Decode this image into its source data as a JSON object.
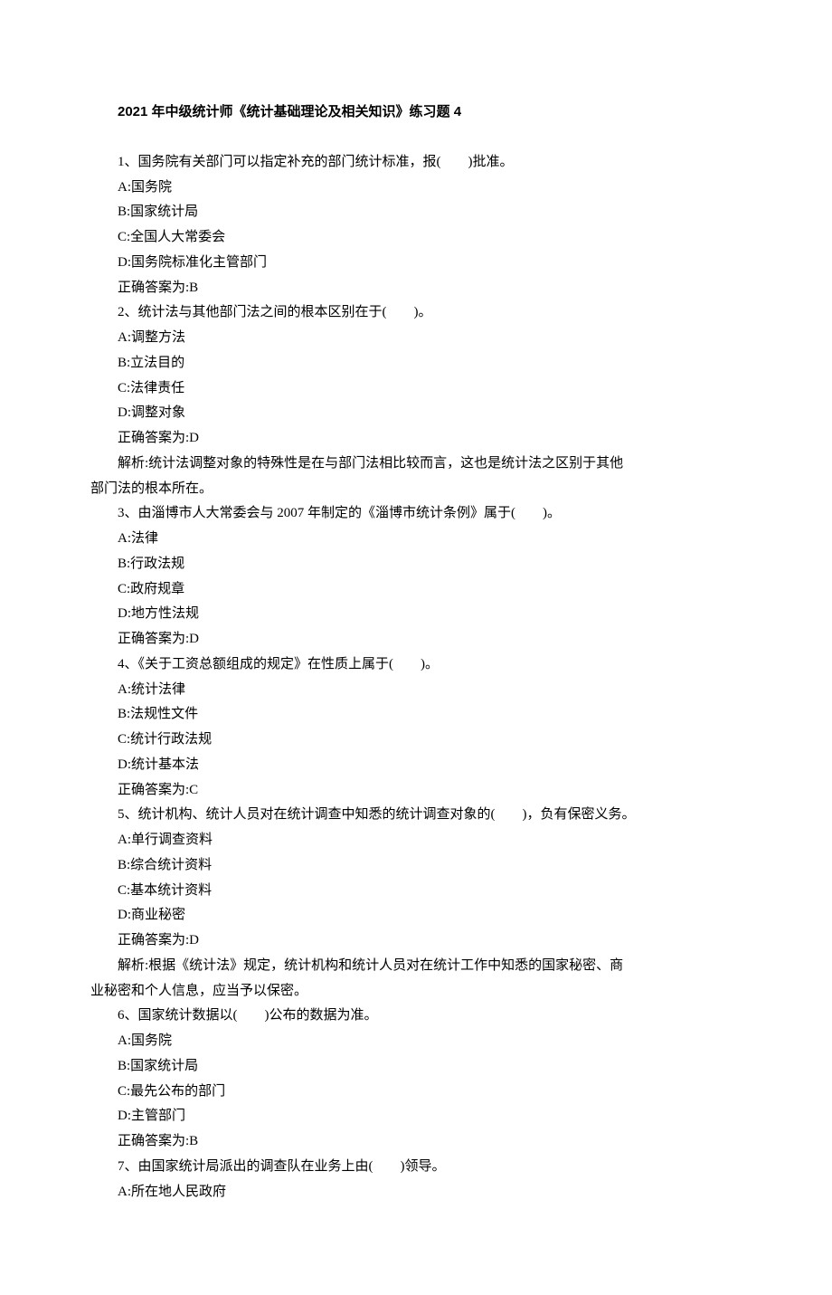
{
  "title": "2021 年中级统计师《统计基础理论及相关知识》练习题 4",
  "q1": {
    "stem": "1、国务院有关部门可以指定补充的部门统计标准，报(　　)批准。",
    "a": "A:国务院",
    "b": "B:国家统计局",
    "c": "C:全国人大常委会",
    "d": "D:国务院标准化主管部门",
    "ans": "正确答案为:B"
  },
  "q2": {
    "stem": "2、统计法与其他部门法之间的根本区别在于(　　)。",
    "a": "A:调整方法",
    "b": "B:立法目的",
    "c": "C:法律责任",
    "d": "D:调整对象",
    "ans": "正确答案为:D",
    "exp1": "解析:统计法调整对象的特殊性是在与部门法相比较而言，这也是统计法之区别于其他",
    "exp2": "部门法的根本所在。"
  },
  "q3": {
    "stem": "3、由淄博市人大常委会与 2007 年制定的《淄博市统计条例》属于(　　)。",
    "a": "A:法律",
    "b": "B:行政法规",
    "c": "C:政府规章",
    "d": "D:地方性法规",
    "ans": "正确答案为:D"
  },
  "q4": {
    "stem": "4、《关于工资总额组成的规定》在性质上属于(　　)。",
    "a": "A:统计法律",
    "b": "B:法规性文件",
    "c": "C:统计行政法规",
    "d": "D:统计基本法",
    "ans": "正确答案为:C"
  },
  "q5": {
    "stem": "5、统计机构、统计人员对在统计调查中知悉的统计调查对象的(　　)，负有保密义务。",
    "a": "A:单行调查资料",
    "b": "B:综合统计资料",
    "c": "C:基本统计资料",
    "d": "D:商业秘密",
    "ans": "正确答案为:D",
    "exp1": "解析:根据《统计法》规定，统计机构和统计人员对在统计工作中知悉的国家秘密、商",
    "exp2": "业秘密和个人信息，应当予以保密。"
  },
  "q6": {
    "stem": "6、国家统计数据以(　　)公布的数据为准。",
    "a": "A:国务院",
    "b": "B:国家统计局",
    "c": "C:最先公布的部门",
    "d": "D:主管部门",
    "ans": "正确答案为:B"
  },
  "q7": {
    "stem": "7、由国家统计局派出的调查队在业务上由(　　)领导。",
    "a": "A:所在地人民政府"
  }
}
